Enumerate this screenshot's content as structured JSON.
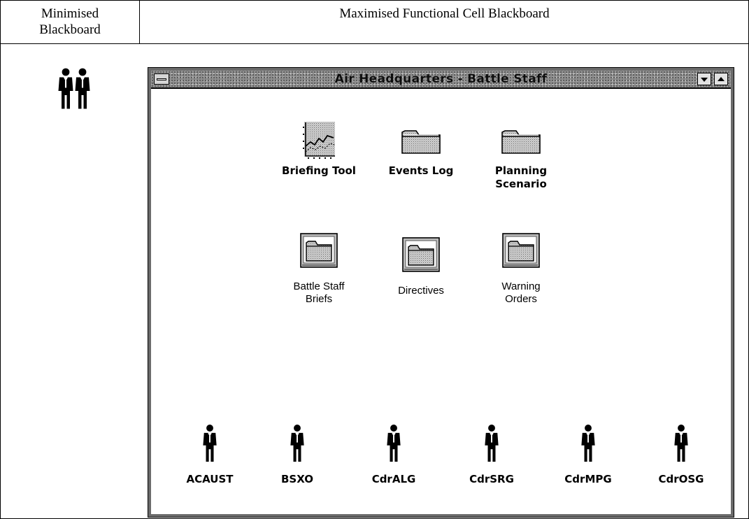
{
  "header": {
    "left_title": "Minimised\nBlackboard",
    "right_title": "Maximised Functional Cell Blackboard"
  },
  "minimised": {
    "icon": "group-people-icon"
  },
  "window": {
    "title": "Air Headquarters - Battle Staff",
    "controls": [
      "system-menu",
      "minimize",
      "maximize"
    ]
  },
  "tools": [
    {
      "label": "Briefing Tool",
      "icon": "chart-icon"
    },
    {
      "label": "Events Log",
      "icon": "folder-icon"
    },
    {
      "label": "Planning\nScenario",
      "icon": "folder-icon"
    }
  ],
  "folders": [
    {
      "label": "Battle Staff\nBriefs",
      "icon": "framed-folder-icon"
    },
    {
      "label": "Directives",
      "icon": "framed-folder-icon"
    },
    {
      "label": "Warning\nOrders",
      "icon": "framed-folder-icon"
    }
  ],
  "users": [
    {
      "label": "ACAUST",
      "icon": "person-icon"
    },
    {
      "label": "BSXO",
      "icon": "person-icon"
    },
    {
      "label": "CdrALG",
      "icon": "person-icon"
    },
    {
      "label": "CdrSRG",
      "icon": "person-icon"
    },
    {
      "label": "CdrMPG",
      "icon": "person-icon"
    },
    {
      "label": "CdrOSG",
      "icon": "person-icon"
    }
  ]
}
